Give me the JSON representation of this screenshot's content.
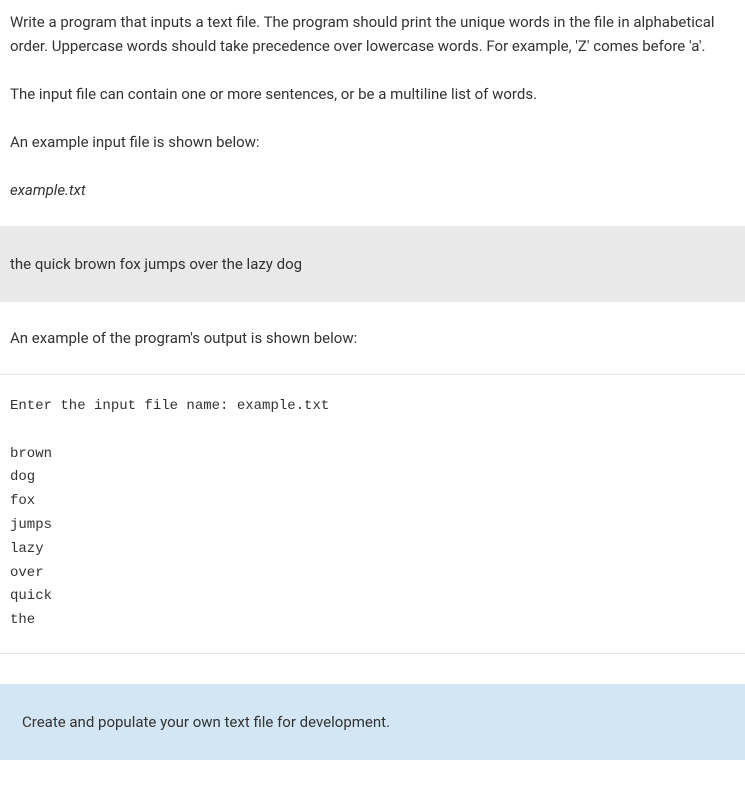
{
  "paragraphs": {
    "intro": "Write a program that inputs a text file. The program should print the unique words in the file in alphabetical order. Uppercase words should take precedence over lowercase words. For example, 'Z' comes before 'a'.",
    "input_desc": "The input file can contain one or more sentences, or be a multiline list of words.",
    "example_input_label": "An example input file is shown below:",
    "filename": "example.txt",
    "example_output_label": "An example of the program's output is shown below:"
  },
  "input_file_content": "the quick brown fox jumps over the lazy dog",
  "output_block": "Enter the input file name: example.txt\n\nbrown\ndog\nfox\njumps\nlazy\nover\nquick\nthe",
  "note": "Create and populate your own text file for development."
}
